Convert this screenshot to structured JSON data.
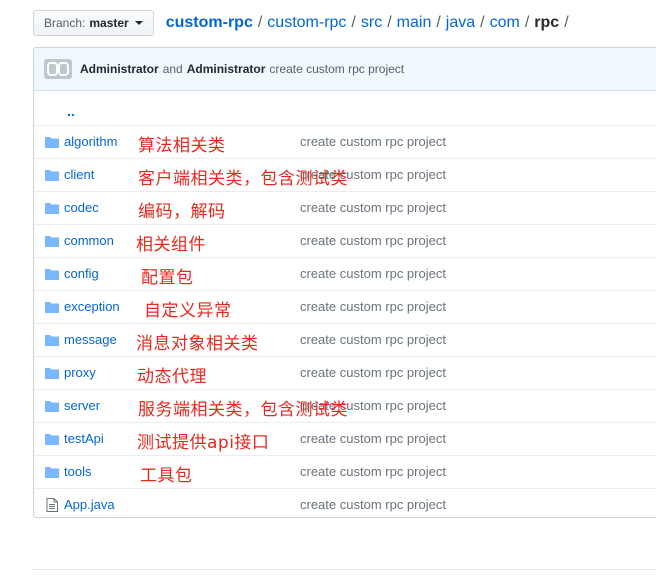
{
  "branch": {
    "label": "Branch:",
    "value": "master"
  },
  "breadcrumb": [
    "custom-rpc",
    "custom-rpc",
    "src",
    "main",
    "java",
    "com",
    "rpc"
  ],
  "breadcrumb_sep": "/",
  "commit": {
    "author1": "Administrator",
    "and": "and",
    "author2": "Administrator",
    "message": "create custom rpc project"
  },
  "parent_link": "..",
  "files": [
    {
      "name": "algorithm",
      "type": "folder",
      "message": "create custom rpc project",
      "note": "算法相关类"
    },
    {
      "name": "client",
      "type": "folder",
      "message": "create custom rpc project",
      "note": "客户端相关类，包含测试类"
    },
    {
      "name": "codec",
      "type": "folder",
      "message": "create custom rpc project",
      "note": "编码，解码"
    },
    {
      "name": "common",
      "type": "folder",
      "message": "create custom rpc project",
      "note": "相关组件"
    },
    {
      "name": "config",
      "type": "folder",
      "message": "create custom rpc project",
      "note": "配置包"
    },
    {
      "name": "exception",
      "type": "folder",
      "message": "create custom rpc project",
      "note": "自定义异常"
    },
    {
      "name": "message",
      "type": "folder",
      "message": "create custom rpc project",
      "note": "消息对象相关类"
    },
    {
      "name": "proxy",
      "type": "folder",
      "message": "create custom rpc project",
      "note": "动态代理"
    },
    {
      "name": "server",
      "type": "folder",
      "message": "create custom rpc project",
      "note": "服务端相关类，包含测试类"
    },
    {
      "name": "testApi",
      "type": "folder",
      "message": "create custom rpc project",
      "note": "测试提供api接口"
    },
    {
      "name": "tools",
      "type": "folder",
      "message": "create custom rpc project",
      "note": "工具包"
    },
    {
      "name": "App.java",
      "type": "file",
      "message": "create custom rpc project",
      "note": ""
    }
  ],
  "colors": {
    "link": "#0366d6",
    "folder_icon": "#79b8ff",
    "annotation": "#e8281f"
  }
}
